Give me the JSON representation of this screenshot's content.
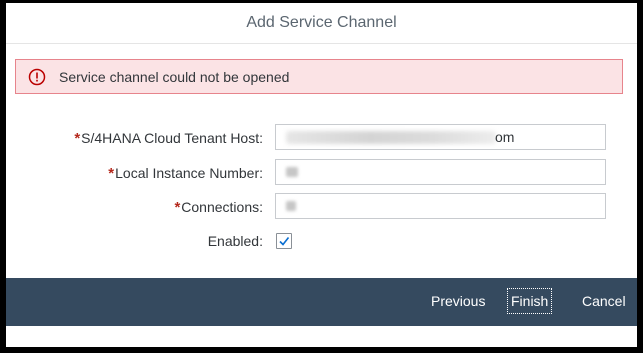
{
  "dialog": {
    "title": "Add Service Channel"
  },
  "error": {
    "icon": "alert-circle-icon",
    "message": "Service channel could not be opened",
    "color": "#e7848c"
  },
  "form": {
    "required_marker": "*",
    "host": {
      "label": "S/4HANA Cloud Tenant Host:",
      "value_suffix": "om"
    },
    "instance": {
      "label": "Local Instance Number:"
    },
    "connections": {
      "label": "Connections:"
    },
    "enabled": {
      "label": "Enabled:",
      "checked": true
    }
  },
  "footer": {
    "previous_label": "Previous",
    "finish_label": "Finish",
    "cancel_label": "Cancel",
    "background": "#354a5f"
  }
}
